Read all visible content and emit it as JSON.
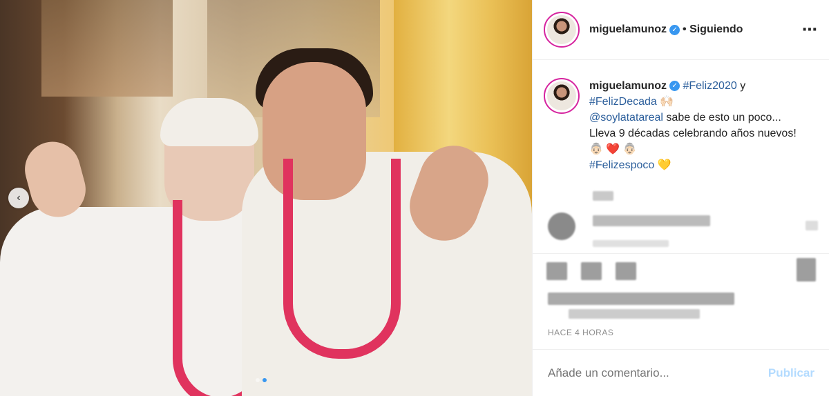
{
  "post": {
    "username": "miguelamunoz",
    "follow_status": "• Siguiendo",
    "more_icon": "⋯",
    "caption": {
      "username": "miguelamunoz",
      "tag1": "#Feliz2020",
      "and": " y",
      "tag2": "#FelizDecada",
      "emoji1": "🙌🏻",
      "mention": "@soylatatareal",
      "text1": " sabe de esto un poco...",
      "text2": "Lleva 9 décadas celebrando años nuevos!",
      "emoji2": "👵🏻 ❤️ 👵🏻",
      "tag3": "#Felizespoco",
      "emoji3": "💛"
    },
    "timestamp": "HACE 4 HORAS",
    "comment_placeholder": "Añade un comentario...",
    "publish_label": "Publicar"
  }
}
